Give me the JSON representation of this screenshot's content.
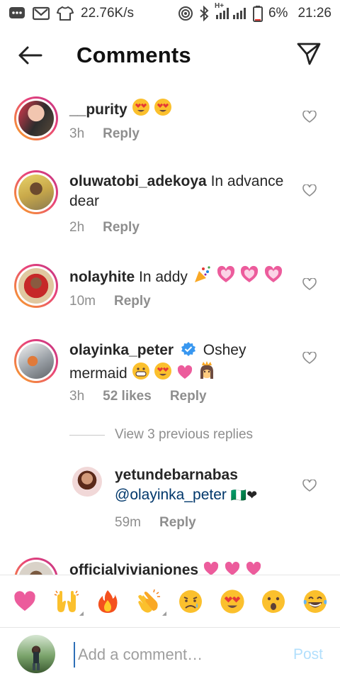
{
  "status_bar": {
    "speed": "22.76K/s",
    "network_type": "H+",
    "battery": "6%",
    "time": "21:26",
    "icons": [
      "message-icon",
      "gmail-icon",
      "shirt-icon",
      "hotspot-icon",
      "bluetooth-icon",
      "signal-icon",
      "battery-icon"
    ]
  },
  "header": {
    "title": "Comments",
    "back_icon": "arrow-left-icon",
    "share_icon": "send-icon"
  },
  "comments": [
    {
      "username": "__purity",
      "text": "",
      "emojis": [
        "😍",
        "😍"
      ],
      "time": "3h",
      "reply_label": "Reply"
    },
    {
      "username": "oluwatobi_adekoya",
      "text": "In advance dear",
      "emojis": [],
      "time": "2h",
      "reply_label": "Reply"
    },
    {
      "username": "nolayhite",
      "text": "In addy",
      "emojis": [
        "🎊",
        "💗",
        "💗",
        "💗"
      ],
      "time": "10m",
      "reply_label": "Reply"
    },
    {
      "username": "olayinka_peter",
      "verified": true,
      "text": "Oshey mermaid",
      "emojis": [
        "😁",
        "😍",
        "❤",
        "👸"
      ],
      "time": "3h",
      "likes": "52 likes",
      "reply_label": "Reply"
    }
  ],
  "view_replies_label": "View 3 previous replies",
  "reply": {
    "username": "yetundebarnabas",
    "mention": "@olayinka_peter",
    "trailing": "🇳🇬❤",
    "time": "59m",
    "reply_label": "Reply"
  },
  "partial_comment": {
    "username": "officialvivianjones",
    "emojis": [
      "💗",
      "💗",
      "💗"
    ]
  },
  "emoji_bar": [
    "❤",
    "🙌",
    "🔥",
    "👏",
    "😢",
    "😍",
    "😮",
    "😂"
  ],
  "compose": {
    "placeholder": "Add a comment…",
    "post_label": "Post"
  },
  "colors": {
    "ring_start": "#f9a825",
    "ring_end": "#c13584",
    "post_disabled": "#b2dffc",
    "verified": "#3897f0"
  }
}
